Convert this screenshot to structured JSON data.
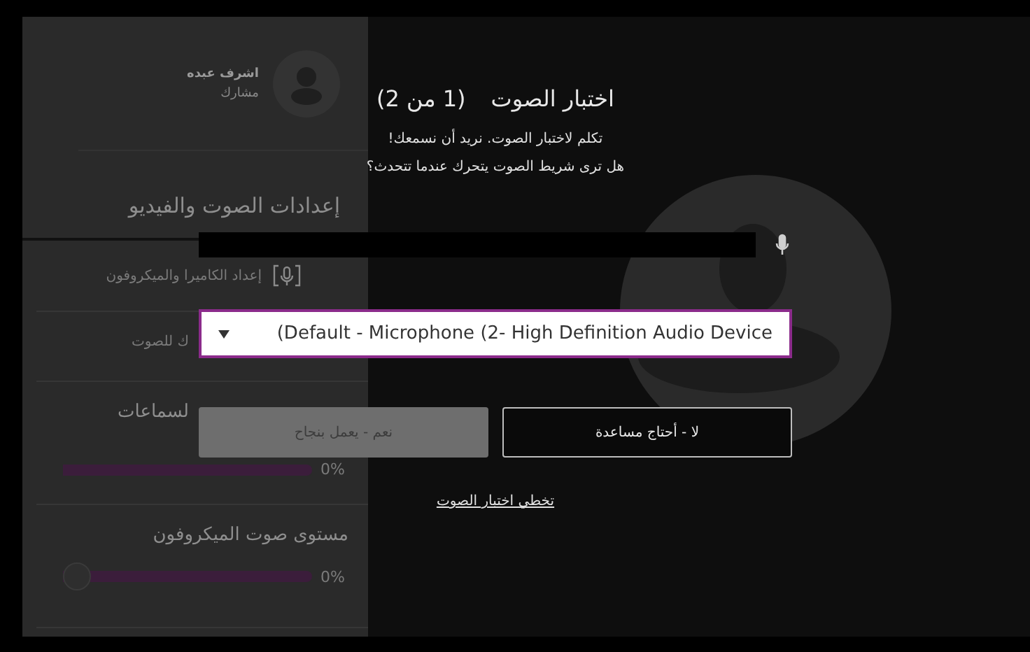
{
  "sidebar": {
    "user": {
      "name": "اشرف عبده",
      "role": "مشارك"
    },
    "title": "إعدادات الصوت والفيديو",
    "items": [
      {
        "kind": "icon",
        "label": "إعداد الكاميرا والميكروفون"
      },
      {
        "kind": "covered",
        "label": "ك للصوت"
      }
    ],
    "sliders": [
      {
        "kind": "covered",
        "label": "لسماعات",
        "level": 0,
        "reading": "0%"
      },
      {
        "kind": "full",
        "label": "مستوى صوت الميكروفون",
        "level": 0,
        "reading": "0%"
      }
    ]
  },
  "dialog": {
    "title": "اختبار الصوت",
    "step": "(1 من 2)",
    "lines": [
      "تكلم لاختبار الصوت. نريد أن نسمعك!",
      "هل ترى شريط الصوت يتحرك عندما تتحدث؟"
    ],
    "mic_meter": {
      "level": 0
    },
    "device": "(Default - Microphone (2- High Definition Audio Device",
    "buttons": [
      {
        "label": "لا - أحتاج مساعدة",
        "disabled": false
      },
      {
        "label": "نعم - يعمل بنجاح",
        "disabled": true
      }
    ],
    "skip_link": "تخطي اختبار الصوت"
  }
}
